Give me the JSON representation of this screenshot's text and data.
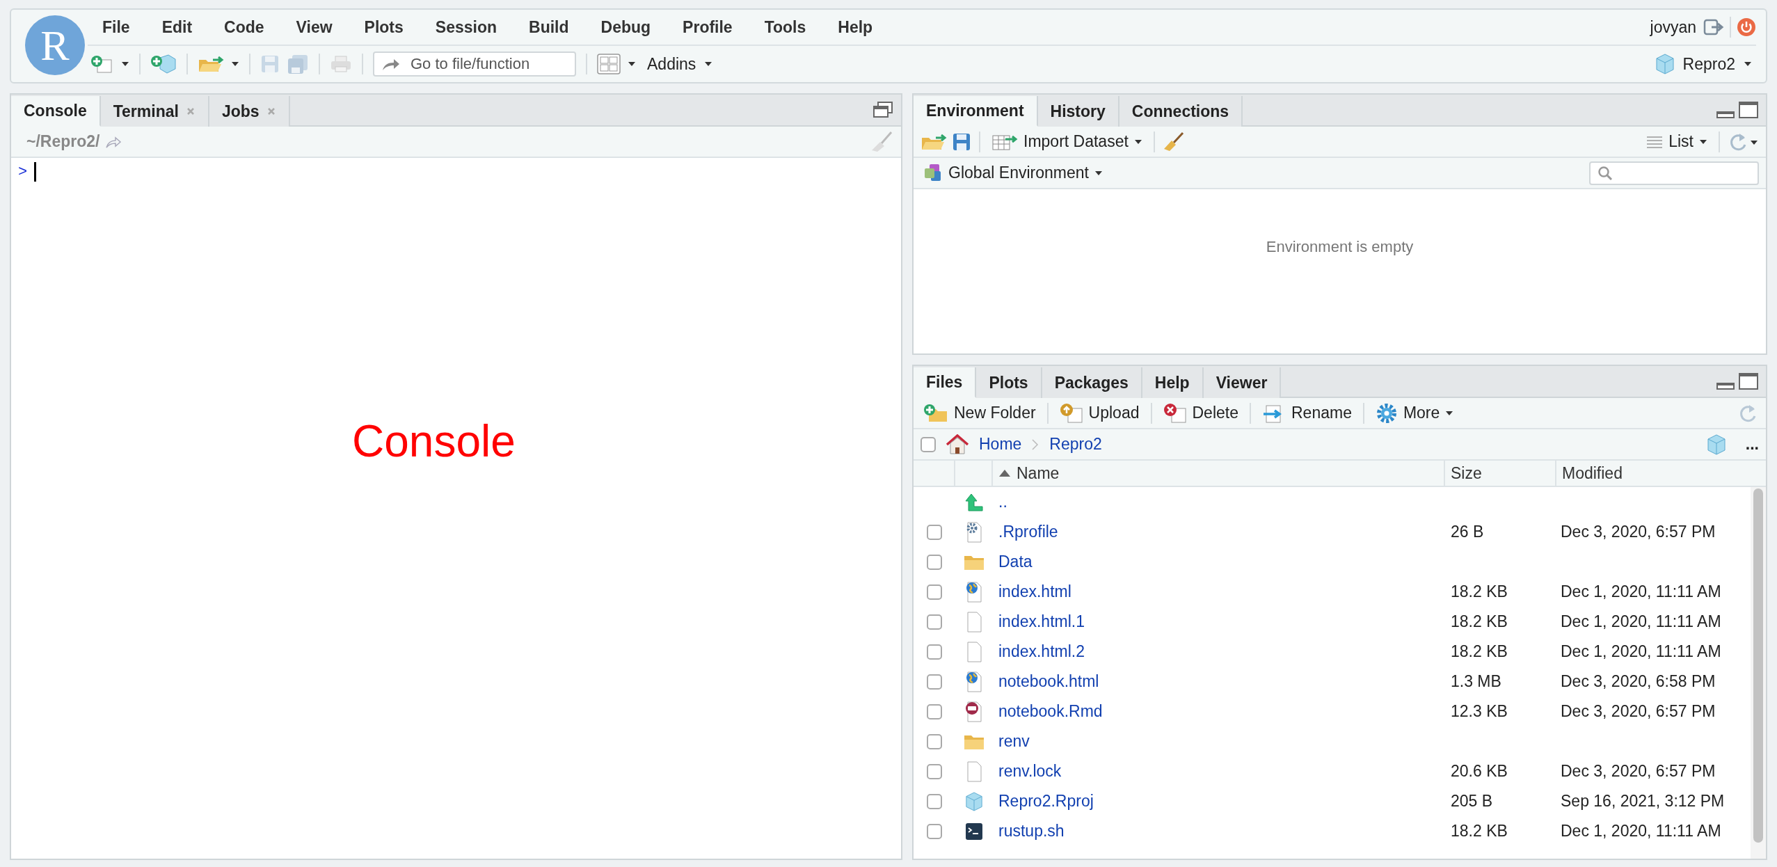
{
  "menu_bar": {
    "logo_text": "R",
    "items": [
      "File",
      "Edit",
      "Code",
      "View",
      "Plots",
      "Session",
      "Build",
      "Debug",
      "Profile",
      "Tools",
      "Help"
    ],
    "user": "jovyan"
  },
  "toolbar": {
    "goto_placeholder": "Go to file/function",
    "addins": "Addins",
    "project": "Repro2"
  },
  "console_pane": {
    "tabs": [
      {
        "label": "Console",
        "selected": true,
        "closable": false
      },
      {
        "label": "Terminal",
        "selected": false,
        "closable": true
      },
      {
        "label": "Jobs",
        "selected": false,
        "closable": true
      }
    ],
    "path": "~/Repro2/",
    "prompt": ">",
    "overlay_label": "Console"
  },
  "environment_pane": {
    "tabs": [
      {
        "label": "Environment",
        "selected": true
      },
      {
        "label": "History",
        "selected": false
      },
      {
        "label": "Connections",
        "selected": false
      }
    ],
    "import_dataset": "Import Dataset",
    "view_mode": "List",
    "scope": "Global Environment",
    "empty_message": "Environment is empty"
  },
  "files_pane": {
    "tabs": [
      {
        "label": "Files",
        "selected": true
      },
      {
        "label": "Plots",
        "selected": false
      },
      {
        "label": "Packages",
        "selected": false
      },
      {
        "label": "Help",
        "selected": false
      },
      {
        "label": "Viewer",
        "selected": false
      }
    ],
    "actions": [
      {
        "kind": "new-folder",
        "label": "New Folder"
      },
      {
        "kind": "upload",
        "label": "Upload"
      },
      {
        "kind": "delete",
        "label": "Delete"
      },
      {
        "kind": "rename",
        "label": "Rename"
      },
      {
        "kind": "more",
        "label": "More"
      }
    ],
    "breadcrumb": [
      "Home",
      "Repro2"
    ],
    "select_all_checked": false,
    "overflow": "...",
    "columns": [
      {
        "label": "Name",
        "sorted": true
      },
      {
        "label": "Size",
        "sorted": false
      },
      {
        "label": "Modified",
        "sorted": false
      }
    ],
    "rows": [
      {
        "kind": "parent",
        "name": ".."
      },
      {
        "kind": "config",
        "name": ".Rprofile",
        "size": "26 B",
        "modified": "Dec 3, 2020, 6:57 PM",
        "checked": false
      },
      {
        "kind": "folder",
        "name": "Data",
        "checked": false
      },
      {
        "kind": "web",
        "name": "index.html",
        "size": "18.2 KB",
        "modified": "Dec 1, 2020, 11:11 AM",
        "checked": false
      },
      {
        "kind": "blank",
        "name": "index.html.1",
        "size": "18.2 KB",
        "modified": "Dec 1, 2020, 11:11 AM",
        "checked": false
      },
      {
        "kind": "blank",
        "name": "index.html.2",
        "size": "18.2 KB",
        "modified": "Dec 1, 2020, 11:11 AM",
        "checked": false
      },
      {
        "kind": "web",
        "name": "notebook.html",
        "size": "1.3 MB",
        "modified": "Dec 3, 2020, 6:58 PM",
        "checked": false
      },
      {
        "kind": "rmd",
        "name": "notebook.Rmd",
        "size": "12.3 KB",
        "modified": "Dec 3, 2020, 6:57 PM",
        "checked": false
      },
      {
        "kind": "folder",
        "name": "renv",
        "checked": false
      },
      {
        "kind": "blank",
        "name": "renv.lock",
        "size": "20.6 KB",
        "modified": "Dec 3, 2020, 6:57 PM",
        "checked": false
      },
      {
        "kind": "rproj",
        "name": "Repro2.Rproj",
        "size": "205 B",
        "modified": "Sep 16, 2021, 3:12 PM",
        "checked": false
      },
      {
        "kind": "script",
        "name": "rustup.sh",
        "size": "18.2 KB",
        "modified": "Dec 1, 2020, 11:11 AM",
        "checked": false
      }
    ]
  }
}
